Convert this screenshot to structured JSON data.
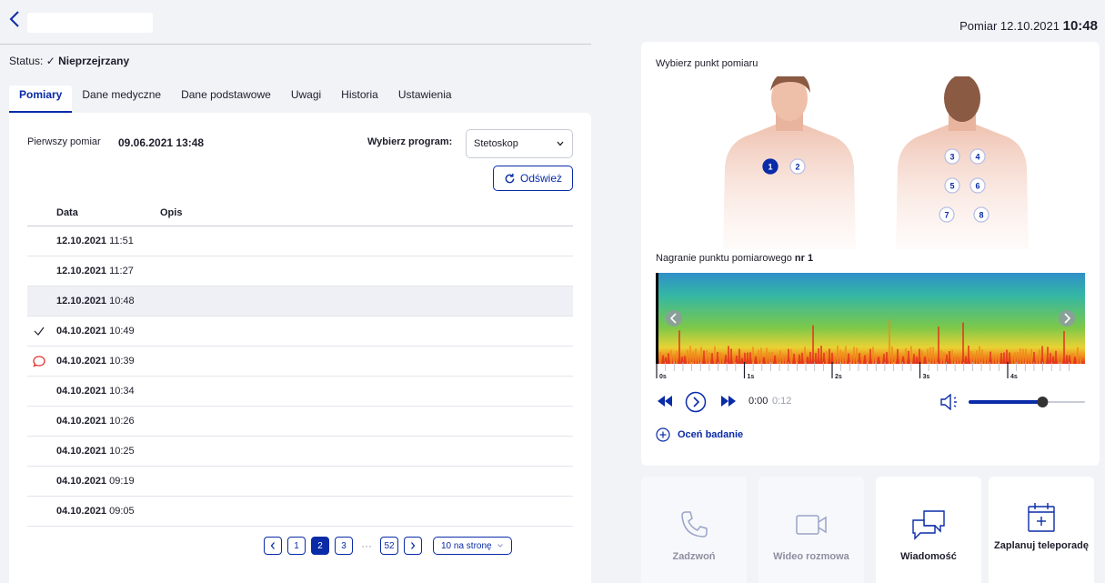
{
  "header": {
    "measurement_label": "Pomiar",
    "measurement_date": "12.10.2021",
    "measurement_time": "10:48"
  },
  "status": {
    "label": "Status:",
    "value": "Nieprzejrzany"
  },
  "tabs": [
    {
      "label": "Pomiary",
      "active": true
    },
    {
      "label": "Dane medyczne"
    },
    {
      "label": "Dane podstawowe"
    },
    {
      "label": "Uwagi"
    },
    {
      "label": "Historia"
    },
    {
      "label": "Ustawienia"
    }
  ],
  "measurements": {
    "first_label": "Pierwszy pomiar",
    "first_value": "09.06.2021 13:48",
    "program_label": "Wybierz program:",
    "program_value": "Stetoskop",
    "refresh_label": "Odśwież",
    "columns": [
      "Data",
      "Opis"
    ],
    "rows": [
      {
        "date": "12.10.2021",
        "time": "11:51"
      },
      {
        "date": "12.10.2021",
        "time": "11:27"
      },
      {
        "date": "12.10.2021",
        "time": "10:48",
        "selected": true
      },
      {
        "date": "04.10.2021",
        "time": "10:49",
        "mark": "check-icon"
      },
      {
        "date": "04.10.2021",
        "time": "10:39",
        "mark": "comment-icon"
      },
      {
        "date": "04.10.2021",
        "time": "10:34"
      },
      {
        "date": "04.10.2021",
        "time": "10:26"
      },
      {
        "date": "04.10.2021",
        "time": "10:25"
      },
      {
        "date": "04.10.2021",
        "time": "09:19"
      },
      {
        "date": "04.10.2021",
        "time": "09:05"
      }
    ]
  },
  "pagination": {
    "pages": [
      "1",
      "2",
      "3"
    ],
    "active": "2",
    "dots": "···",
    "last": "52",
    "per_page": "10 na stronę"
  },
  "auscultation": {
    "choose_point_label": "Wybierz punkt pomiaru",
    "points_front": [
      "1",
      "2"
    ],
    "points_back": [
      "3",
      "4",
      "5",
      "6",
      "7",
      "8"
    ],
    "active_point": "1",
    "recording_label": "Nagranie punktu pomiarowego",
    "recording_point": "nr 1",
    "timeline_labels": [
      "0s",
      "1s",
      "2s",
      "3s",
      "4s"
    ],
    "current_time": "0:00",
    "duration": "0:12",
    "volume_fraction": 0.64,
    "rate_label": "Oceń badanie"
  },
  "actions": [
    {
      "label": "Zadzwoń",
      "icon": "phone-icon",
      "enabled": false
    },
    {
      "label": "Wideo rozmowa",
      "icon": "video-icon",
      "enabled": false
    },
    {
      "label": "Wiadomość",
      "icon": "message-icon",
      "enabled": true
    },
    {
      "label": "Zaplanuj teleporadę",
      "icon": "calendar-plus-icon",
      "enabled": true
    }
  ],
  "colors": {
    "accent": "#0a2ba8",
    "alert": "#e3342f",
    "background": "#f2f3f7"
  }
}
